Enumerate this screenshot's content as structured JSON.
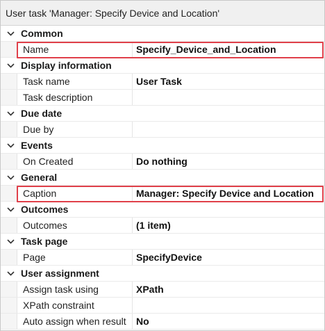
{
  "window": {
    "title": "User task 'Manager: Specify Device and Location'"
  },
  "colors": {
    "highlight": "#e0404a"
  },
  "sections": [
    {
      "label": "Common",
      "properties": [
        {
          "name": "Name",
          "value": "Specify_Device_and_Location",
          "highlighted": true
        }
      ]
    },
    {
      "label": "Display information",
      "properties": [
        {
          "name": "Task name",
          "value": "User Task"
        },
        {
          "name": "Task description",
          "value": ""
        }
      ]
    },
    {
      "label": "Due date",
      "properties": [
        {
          "name": "Due by",
          "value": ""
        }
      ]
    },
    {
      "label": "Events",
      "properties": [
        {
          "name": "On Created",
          "value": "Do nothing"
        }
      ]
    },
    {
      "label": "General",
      "properties": [
        {
          "name": "Caption",
          "value": "Manager: Specify Device and Location",
          "highlighted": true
        }
      ]
    },
    {
      "label": "Outcomes",
      "properties": [
        {
          "name": "Outcomes",
          "value": "(1 item)"
        }
      ]
    },
    {
      "label": "Task page",
      "properties": [
        {
          "name": "Page",
          "value": "SpecifyDevice"
        }
      ]
    },
    {
      "label": "User assignment",
      "properties": [
        {
          "name": "Assign task using",
          "value": "XPath"
        },
        {
          "name": "XPath constraint",
          "value": ""
        },
        {
          "name": "Auto assign when result",
          "value": "No"
        }
      ]
    }
  ]
}
